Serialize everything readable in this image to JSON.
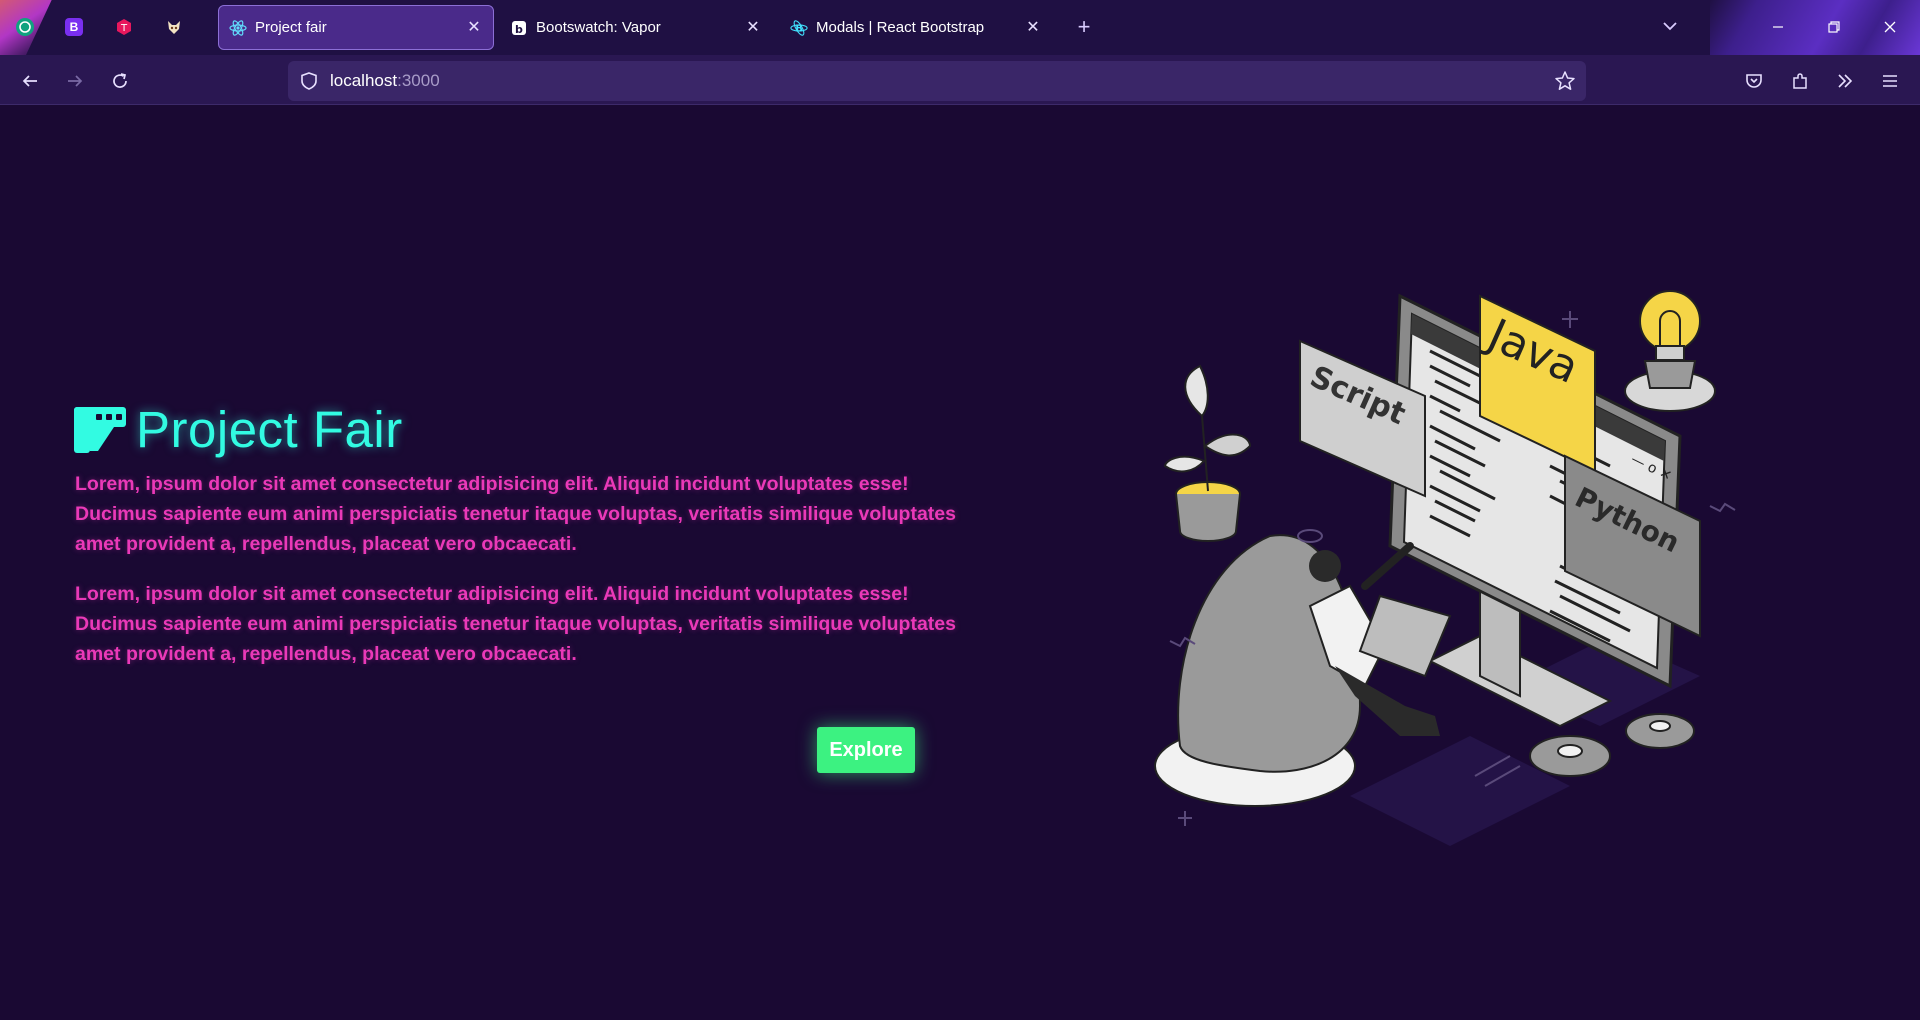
{
  "browser": {
    "pinned_tabs": [
      {
        "icon": "openai-icon",
        "color": "#10a37f"
      },
      {
        "icon": "bootstrap-icon",
        "color": "#7a2ff0",
        "glyph": "B"
      },
      {
        "icon": "typing-icon",
        "color": "#e8175d"
      },
      {
        "icon": "fox-mascot-icon",
        "color": "#e8a24a"
      }
    ],
    "tabs": [
      {
        "title": "Project fair",
        "icon": "react-icon",
        "active": true
      },
      {
        "title": "Bootswatch: Vapor",
        "icon": "bootswatch-icon",
        "active": false
      },
      {
        "title": "Modals | React Bootstrap",
        "icon": "react-bootstrap-icon",
        "active": false
      }
    ],
    "url": {
      "host": "localhost",
      "port": ":3000"
    }
  },
  "page": {
    "brand": {
      "title": "Project Fair",
      "icon": "project-diagram-icon",
      "color": "#32fbe2"
    },
    "paragraphs": [
      "Lorem, ipsum dolor sit amet consectetur adipisicing elit. Aliquid incidunt voluptates esse! Ducimus sapiente eum animi perspiciatis tenetur itaque voluptas, veritatis similique voluptates amet provident a, repellendus, placeat vero obcaecati.",
      "Lorem, ipsum dolor sit amet consectetur adipisicing elit. Aliquid incidunt voluptates esse! Ducimus sapiente eum animi perspiciatis tenetur itaque voluptas, veritatis similique voluptates amet provident a, repellendus, placeat vero obcaecati."
    ],
    "explore_label": "Explore",
    "illustration": {
      "labels": {
        "script": "Script",
        "java": "Java",
        "python": "Python"
      }
    },
    "colors": {
      "background": "#1a0933",
      "accent_text": "#ea39b8",
      "button": "#3cf281"
    }
  }
}
